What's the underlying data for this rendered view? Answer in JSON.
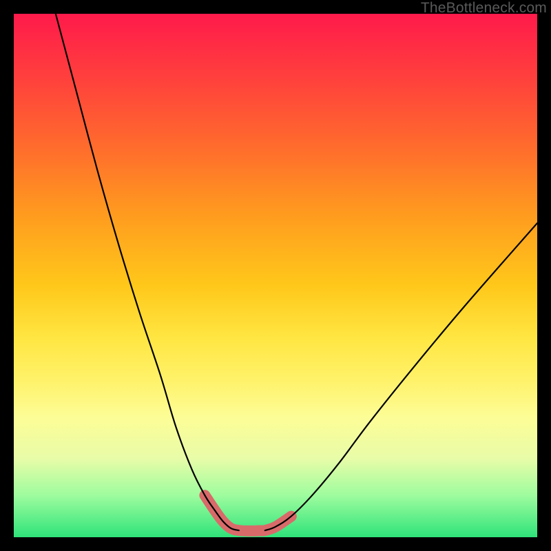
{
  "watermark": "TheBottleneck.com",
  "chart_data": {
    "type": "line",
    "title": "",
    "xlabel": "",
    "ylabel": "",
    "xlim": [
      0,
      100
    ],
    "ylim": [
      0,
      100
    ],
    "series": [
      {
        "name": "left-curve",
        "x": [
          8,
          12,
          16,
          20,
          24,
          28,
          31,
          34,
          36.5,
          38.5,
          40,
          41.5,
          43
        ],
        "y": [
          100,
          85,
          70,
          56,
          43,
          31,
          21,
          13,
          8,
          5,
          3,
          1.7,
          1.3
        ]
      },
      {
        "name": "right-curve",
        "x": [
          48,
          50,
          53,
          57,
          62,
          68,
          76,
          86,
          100
        ],
        "y": [
          1.3,
          2,
          4,
          8,
          14,
          22,
          32,
          44,
          60
        ]
      },
      {
        "name": "valley-highlight",
        "x": [
          36.5,
          38.5,
          40,
          41.5,
          43,
          45,
          47,
          48,
          50,
          53
        ],
        "y": [
          8,
          5,
          3,
          1.7,
          1.3,
          1.2,
          1.25,
          1.3,
          2,
          4
        ]
      }
    ],
    "colors": {
      "curve": "#000000",
      "highlight": "#d96a6a"
    }
  }
}
